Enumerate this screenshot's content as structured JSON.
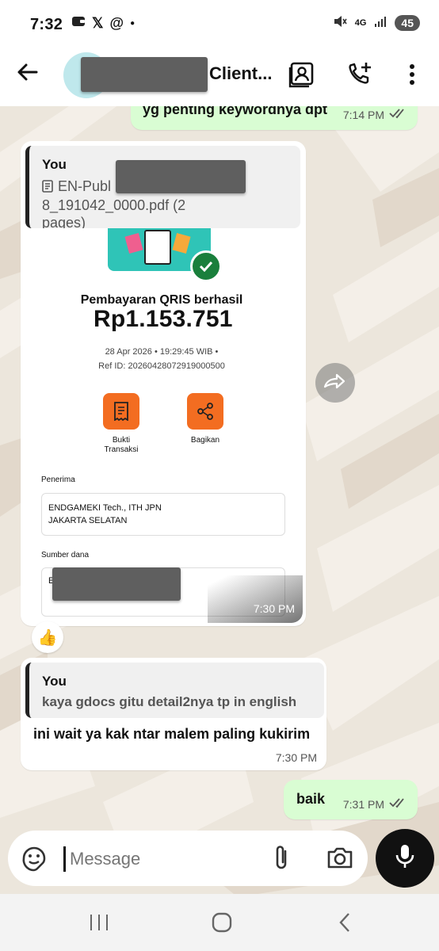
{
  "status_bar": {
    "time": "7:32",
    "network": "4G",
    "battery": "45"
  },
  "header": {
    "title": "Client..."
  },
  "messages": {
    "m1": {
      "text": "yg penting keywordnya dpt",
      "time": "7:14 PM"
    },
    "m2": {
      "quote_author": "You",
      "quote_file_line1": "EN-Publ",
      "quote_file_line2": "8_191042_0000.pdf (2",
      "quote_file_line3": "pages)",
      "time": "7:30 PM",
      "doc": {
        "title": "Pembayaran QRIS berhasil",
        "amount": "Rp1.153.751",
        "datetime": "28 Apr 2026 • 19:29:45 WIB •",
        "ref": "Ref ID: 20260428072919000500",
        "action1_line1": "Bukti",
        "action1_line2": "Transaksi",
        "action2": "Bagikan",
        "recipient_label": "Penerima",
        "recipient_line1": "ENDGAMEKI Tech., ITH JPN",
        "recipient_line2": "JAKARTA SELATAN",
        "source_label": "Sumber dana",
        "source_prefix": "E"
      }
    },
    "reaction": "👍",
    "m3": {
      "quote_author": "You",
      "quote_text": "kaya gdocs gitu detail2nya tp in english",
      "text": "ini wait ya kak ntar malem paling kukirim",
      "time": "7:30 PM"
    },
    "m4": {
      "text": "baik",
      "time": "7:31 PM"
    }
  },
  "composer": {
    "placeholder": "Message"
  },
  "colors": {
    "outgoing": "#d9fdd3",
    "accent_orange": "#f36d21",
    "green_badge": "#1a7f3c"
  }
}
